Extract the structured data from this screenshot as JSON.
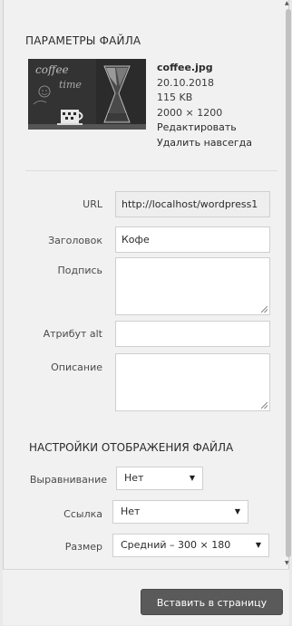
{
  "attachment_details": {
    "heading": "ПАРАМЕТРЫ ФАЙЛА",
    "filename": "coffee.jpg",
    "date": "20.10.2018",
    "filesize": "115 KB",
    "dimensions": "2000 × 1200",
    "edit_link": "Редактировать",
    "delete_link": "Удалить навсегда"
  },
  "thumbnail": {
    "text_line1": "coffee",
    "text_line2": "time"
  },
  "fields": {
    "url_label": "URL",
    "url_value": "http://localhost/wordpress1",
    "title_label": "Заголовок",
    "title_value": "Кофе",
    "caption_label": "Подпись",
    "caption_value": "",
    "alt_label": "Атрибут alt",
    "alt_value": "",
    "description_label": "Описание",
    "description_value": ""
  },
  "display_settings": {
    "heading": "НАСТРОЙКИ ОТОБРАЖЕНИЯ ФАЙЛА",
    "align_label": "Выравнивание",
    "align_value": "Нет",
    "link_label": "Ссылка",
    "link_value": "Нет",
    "size_label": "Размер",
    "size_value": "Средний – 300 × 180"
  },
  "footer": {
    "insert_button": "Вставить в страницу"
  },
  "icons": {
    "dropdown": "triangle-down",
    "resize": "resize-grip"
  },
  "colors": {
    "button": "#5a5a5a",
    "panel": "#f1f1f1"
  }
}
